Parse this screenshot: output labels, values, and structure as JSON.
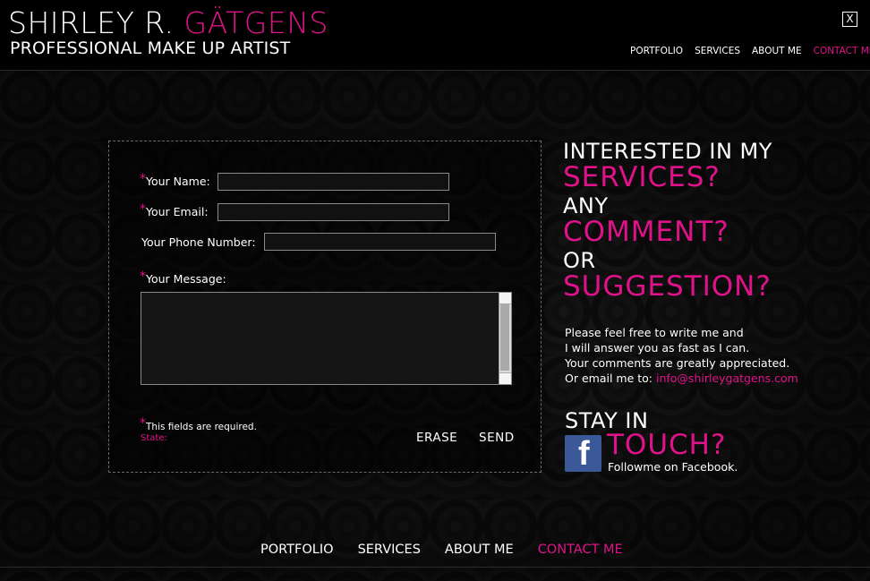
{
  "header": {
    "name_first": "SHIRLEY R. ",
    "name_last": "GÄTGENS",
    "subtitle": "PROFESSIONAL MAKE UP ARTIST",
    "close_label": "X",
    "nav": [
      {
        "label": "PORTFOLIO"
      },
      {
        "label": "SERVICES"
      },
      {
        "label": "ABOUT ME"
      },
      {
        "label": "CONTACT ME"
      }
    ]
  },
  "form": {
    "required_mark": "*",
    "name_label": "Your Name:",
    "email_label": "Your Email:",
    "phone_label": "Your Phone Number:",
    "message_label": "Your Message:",
    "name_value": "",
    "email_value": "",
    "phone_value": "",
    "message_value": "",
    "required_note": "This fields are required.",
    "state_label": "State:",
    "erase_label": "ERASE",
    "send_label": "SEND"
  },
  "aside": {
    "line1": "INTERESTED IN MY",
    "line2": "SERVICES?",
    "line3": "ANY",
    "line4": "COMMENT?",
    "line5": "OR",
    "line6": "SUGGESTION?",
    "para1": "Please feel free to write me and",
    "para2": "I will answer you as fast as I can.",
    "para3": "Your comments are greatly appreciated.",
    "para4_prefix": "Or email me to: ",
    "email": "info@shirleygatgens.com",
    "stay": "STAY IN",
    "touch": "TOUCH?",
    "follow": "Followme on Facebook.",
    "fb_glyph": "f"
  },
  "colors": {
    "accent": "#e0128a",
    "facebook": "#3b5998"
  },
  "footer": {
    "nav": [
      {
        "label": "PORTFOLIO"
      },
      {
        "label": "SERVICES"
      },
      {
        "label": "ABOUT ME"
      },
      {
        "label": "CONTACT ME"
      }
    ]
  }
}
